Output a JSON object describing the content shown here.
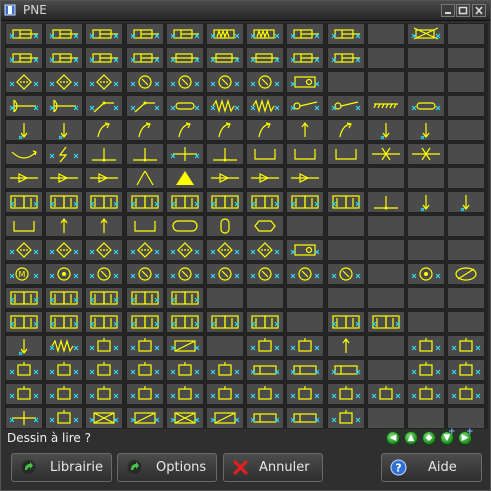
{
  "window": {
    "title": "PNE"
  },
  "icons": {
    "app": "book-icon",
    "minimize": "minimize-icon",
    "maximize": "maximize-icon",
    "close": "close-icon",
    "librairie": "green-arrow-icon",
    "options": "green-arrow-icon",
    "annuler": "red-x-icon",
    "aide": "help-icon"
  },
  "symbol_colors": {
    "stroke": "#ffff00",
    "ports": "#33ddff",
    "cell": "#4b4b4b"
  },
  "symbol_grid": {
    "rows": [
      [
        "cylinder",
        "cylinder",
        "cylinder",
        "cylinder",
        "cylinder",
        "cylinder-spring",
        "cylinder-spring",
        "cylinder",
        "cylinder",
        "empty",
        "cylinder-crossed",
        "empty"
      ],
      [
        "cylinder-double",
        "cylinder-stepped",
        "cylinder",
        "cylinder",
        "cylinder-rod",
        "cylinder-rod",
        "cylinder-piston",
        "cylinder-tandem",
        "cylinder",
        "empty",
        "empty",
        "empty"
      ],
      [
        "filter",
        "separator",
        "lubricator",
        "gauge",
        "gauge",
        "motor",
        "pump",
        "drive-unit",
        "empty",
        "empty",
        "empty",
        "empty"
      ],
      [
        "push-button",
        "button-head",
        "lever",
        "pedal",
        "plunger",
        "spring",
        "spring-adjust",
        "roller",
        "roller-lever",
        "hatch",
        "solenoid",
        "empty"
      ],
      [
        "arrow-down",
        "arrow-down",
        "arrow-diagonal",
        "arrow-curve",
        "arrow-curve",
        "arrow-diagonal",
        "corner-arrow",
        "arrow-up",
        "arrow-diagonal",
        "arrow-down",
        "arrow-down",
        "empty"
      ],
      [
        "arc-arrow",
        "lightning",
        "line-tee",
        "junction",
        "cross",
        "line-tee",
        "valve-base",
        "bracket",
        "bracket",
        "cross-line",
        "cross-line",
        "empty"
      ],
      [
        "check-valve",
        "check-valve",
        "check-valve",
        "cone",
        "triangle-filled",
        "throttle",
        "throttle",
        "throttle",
        "empty",
        "empty",
        "empty",
        "empty"
      ],
      [
        "valve-2pos",
        "valve-2pos",
        "valve-2pos",
        "valve-2pos",
        "valve-2pos",
        "valve-3pos",
        "valve-3pos",
        "valve-3pos",
        "valve-3pos",
        "tee",
        "arrow-down",
        "arrow-down"
      ],
      [
        "bracket",
        "arrow-up",
        "arrow-up",
        "bracket",
        "rounded-box",
        "capsule",
        "hexagon",
        "empty",
        "empty",
        "empty",
        "empty",
        "empty"
      ],
      [
        "filter",
        "filter",
        "filter",
        "filter",
        "filter",
        "filter",
        "filter",
        "motor-box",
        "empty",
        "empty",
        "empty",
        "empty"
      ],
      [
        "motor-m",
        "pump-circle",
        "pump",
        "pump",
        "pump",
        "pump",
        "pump",
        "pump",
        "pump",
        "empty",
        "pneumatic-motor",
        "crossed-oval"
      ],
      [
        "valve-lines",
        "valve-lines",
        "valve-lines",
        "valve-lines",
        "valve-hatched",
        "empty",
        "empty",
        "empty",
        "empty",
        "empty",
        "empty",
        "empty"
      ],
      [
        "valve-lines",
        "valve-lines",
        "valve-lines",
        "valve-lines",
        "valve-lines",
        "valve-lines",
        "valve-lines",
        "empty",
        "valve-lines",
        "valve-lines",
        "empty",
        "empty"
      ],
      [
        "arrow-down",
        "spring",
        "box",
        "box-circle",
        "box-hatched",
        "empty",
        "box",
        "box",
        "arrow-up",
        "empty",
        "box",
        "box"
      ],
      [
        "box-small",
        "box-small",
        "box-small",
        "box-small",
        "box-small",
        "box-large",
        "box-long",
        "box-long",
        "box-long",
        "empty",
        "box",
        "box"
      ],
      [
        "box-small",
        "box-small",
        "box-small",
        "box-small",
        "box-small",
        "box",
        "box",
        "box",
        "box",
        "box",
        "box",
        "box"
      ],
      [
        "crossed-line",
        "box-small",
        "box-crossed",
        "box-hatched",
        "box-crossed",
        "box-hatched",
        "box-long",
        "box-long",
        "box",
        "empty",
        "empty",
        "empty"
      ]
    ]
  },
  "prompt": "Dessin à lire ?",
  "nav_buttons": [
    {
      "name": "nav-back-button",
      "glyph": "◀",
      "plus": false
    },
    {
      "name": "nav-up-button",
      "glyph": "▲",
      "plus": false
    },
    {
      "name": "nav-diamond-button",
      "glyph": "◆",
      "plus": false
    },
    {
      "name": "nav-add-down-button",
      "glyph": "▼",
      "plus": true
    },
    {
      "name": "nav-add-forward-button",
      "glyph": "▶",
      "plus": true
    }
  ],
  "buttons": {
    "librairie": "Librairie",
    "options": "Options",
    "annuler": "Annuler",
    "aide": "Aide"
  }
}
